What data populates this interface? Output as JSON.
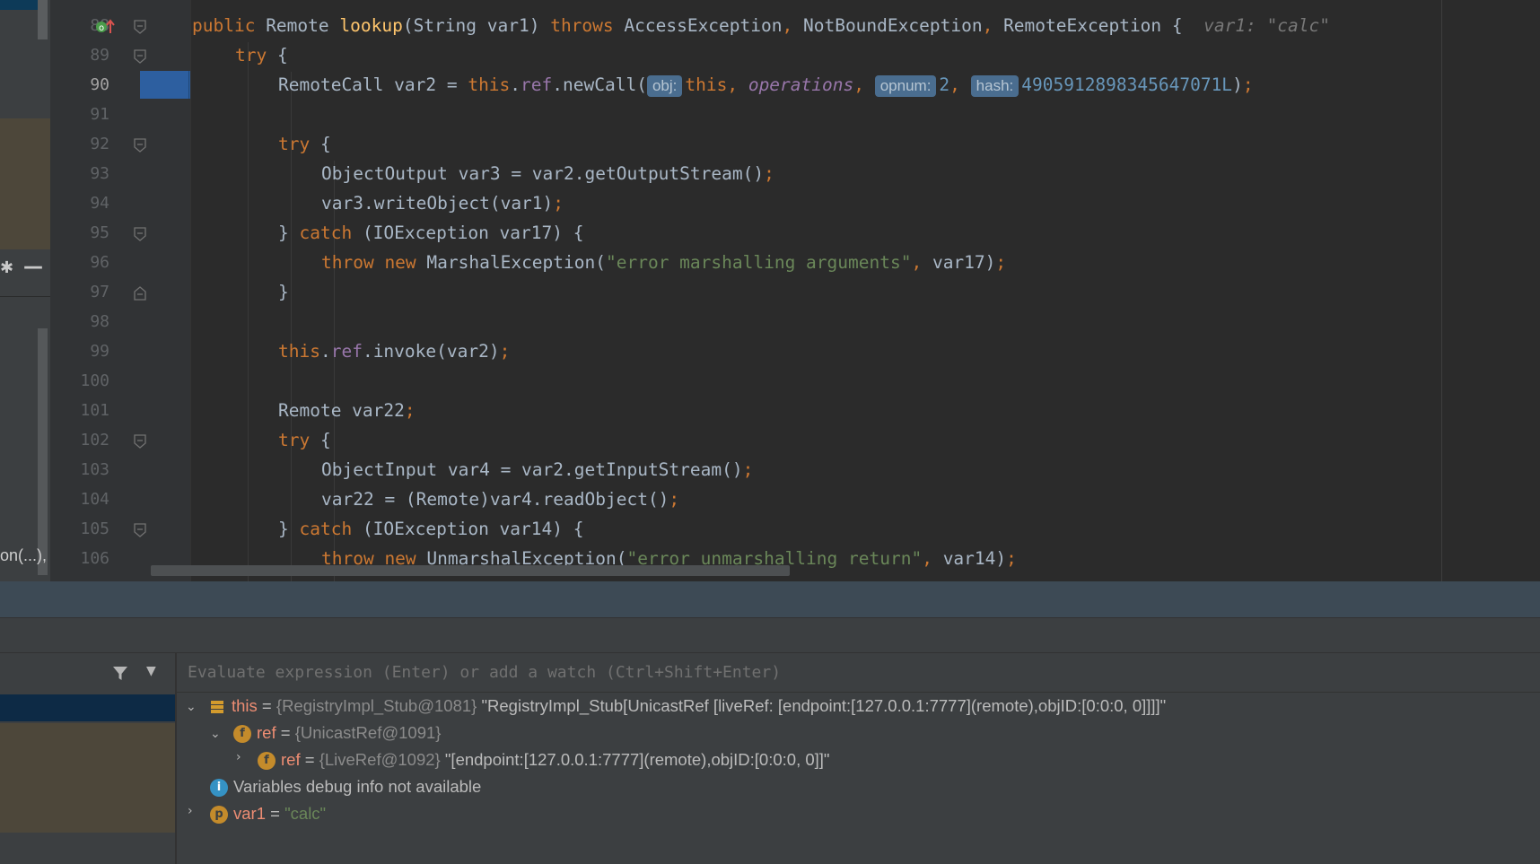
{
  "left_panel": {
    "fragment_text": "on(...), I"
  },
  "gutter": {
    "line_numbers": [
      "88",
      "89",
      "90",
      "91",
      "92",
      "93",
      "94",
      "95",
      "96",
      "97",
      "98",
      "99",
      "100",
      "101",
      "102",
      "103",
      "104",
      "105",
      "106"
    ]
  },
  "editor": {
    "lines": [
      {
        "tokens": [
          [
            "kw",
            "public "
          ],
          [
            "",
            "Remote "
          ],
          [
            "fn",
            "lookup"
          ],
          [
            "",
            "(String var1) "
          ],
          [
            "kw",
            "throws "
          ],
          [
            "",
            "AccessException"
          ],
          [
            "kw",
            ", "
          ],
          [
            "",
            "NotBoundException"
          ],
          [
            "kw",
            ", "
          ],
          [
            "",
            "RemoteException {  "
          ],
          [
            "cmt",
            "var1: \"calc\""
          ]
        ]
      },
      {
        "tokens": [
          [
            "kw",
            "try "
          ],
          [
            "",
            "{"
          ]
        ]
      },
      {
        "tokens": [
          [
            "",
            "RemoteCall var2 = "
          ],
          [
            "kw",
            "this"
          ],
          [
            "",
            "."
          ],
          [
            "fld",
            "ref"
          ],
          [
            "",
            ".newCall("
          ],
          [
            "hint",
            "obj:"
          ],
          [
            "kw",
            "this"
          ],
          [
            "kw",
            ", "
          ],
          [
            "fldi",
            "operations"
          ],
          [
            "kw",
            ", "
          ],
          [
            "hint",
            "opnum:"
          ],
          [
            "num",
            "2"
          ],
          [
            "kw",
            ", "
          ],
          [
            "hint",
            "hash:"
          ],
          [
            "num",
            "4905912898345647071L"
          ],
          [
            "",
            ")"
          ],
          [
            "kw",
            ";"
          ]
        ]
      },
      {
        "tokens": []
      },
      {
        "tokens": [
          [
            "kw",
            "try "
          ],
          [
            "",
            "{"
          ]
        ]
      },
      {
        "tokens": [
          [
            "",
            "ObjectOutput var3 = var2.getOutputStream()"
          ],
          [
            "kw",
            ";"
          ]
        ]
      },
      {
        "tokens": [
          [
            "",
            "var3.writeObject(var1)"
          ],
          [
            "kw",
            ";"
          ]
        ]
      },
      {
        "tokens": [
          [
            "",
            "} "
          ],
          [
            "kw",
            "catch "
          ],
          [
            "",
            "(IOException var17) {"
          ]
        ]
      },
      {
        "tokens": [
          [
            "kw",
            "throw new "
          ],
          [
            "",
            "MarshalException("
          ],
          [
            "str",
            "\"error marshalling arguments\""
          ],
          [
            "kw",
            ", "
          ],
          [
            "",
            "var17)"
          ],
          [
            "kw",
            ";"
          ]
        ]
      },
      {
        "tokens": [
          [
            "",
            "}"
          ]
        ]
      },
      {
        "tokens": []
      },
      {
        "tokens": [
          [
            "kw",
            "this"
          ],
          [
            "",
            "."
          ],
          [
            "fld",
            "ref"
          ],
          [
            "",
            ".invoke(var2)"
          ],
          [
            "kw",
            ";"
          ]
        ]
      },
      {
        "tokens": []
      },
      {
        "tokens": [
          [
            "",
            "Remote var22"
          ],
          [
            "kw",
            ";"
          ]
        ]
      },
      {
        "tokens": [
          [
            "kw",
            "try "
          ],
          [
            "",
            "{"
          ]
        ]
      },
      {
        "tokens": [
          [
            "",
            "ObjectInput var4 = var2.getInputStream()"
          ],
          [
            "kw",
            ";"
          ]
        ]
      },
      {
        "tokens": [
          [
            "",
            "var22 = (Remote)var4.readObject()"
          ],
          [
            "kw",
            ";"
          ]
        ]
      },
      {
        "tokens": [
          [
            "",
            "} "
          ],
          [
            "kw",
            "catch "
          ],
          [
            "",
            "(IOException var14) {"
          ]
        ]
      },
      {
        "tokens": [
          [
            "kw",
            "throw new "
          ],
          [
            "",
            "UnmarshalException("
          ],
          [
            "str",
            "\"error unmarshalling return\""
          ],
          [
            "kw",
            ", "
          ],
          [
            "",
            "var14)"
          ],
          [
            "kw",
            ";"
          ]
        ]
      }
    ]
  },
  "debugger": {
    "watch_placeholder": "Evaluate expression (Enter) or add a watch (Ctrl+Shift+Enter)",
    "variables": [
      {
        "name": "this",
        "eq": " = ",
        "type": "{RegistryImpl_Stub@1081}",
        "value": " \"RegistryImpl_Stub[UnicastRef [liveRef: [endpoint:[127.0.0.1:7777](remote),objID:[0:0:0, 0]]]]\""
      },
      {
        "name": "ref",
        "eq": " = ",
        "type": "{UnicastRef@1091}",
        "value": ""
      },
      {
        "name": "ref",
        "eq": " = ",
        "type": "{LiveRef@1092}",
        "value": " \"[endpoint:[127.0.0.1:7777](remote),objID:[0:0:0, 0]]\""
      },
      {
        "name": "",
        "eq": "",
        "type": "",
        "value": "Variables debug info not available"
      },
      {
        "name": "var1",
        "eq": " = ",
        "type": "",
        "value": "\"calc\""
      }
    ],
    "badges": {
      "field": "f",
      "param": "p",
      "info": "i"
    }
  }
}
